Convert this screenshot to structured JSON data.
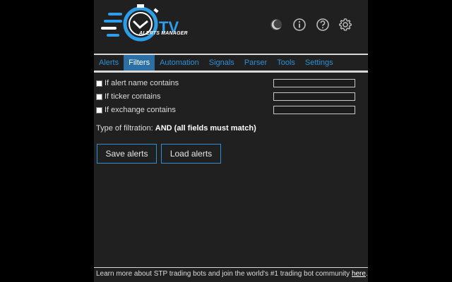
{
  "header": {
    "logo_text": "TV",
    "logo_subtext": "ALERTS MANAGER",
    "icons": [
      "moon-icon",
      "info-icon",
      "help-icon",
      "gear-icon"
    ]
  },
  "tabs": [
    {
      "label": "Alerts",
      "active": false
    },
    {
      "label": "Filters",
      "active": true
    },
    {
      "label": "Automation",
      "active": false
    },
    {
      "label": "Signals",
      "active": false
    },
    {
      "label": "Parser",
      "active": false
    },
    {
      "label": "Tools",
      "active": false
    },
    {
      "label": "Settings",
      "active": false
    }
  ],
  "filters": [
    {
      "label": "If alert name contains",
      "checked": false,
      "value": ""
    },
    {
      "label": "If ticker contains",
      "checked": false,
      "value": ""
    },
    {
      "label": "If exchange contains",
      "checked": false,
      "value": ""
    }
  ],
  "filtration": {
    "prefix": "Type of filtration:",
    "value": "AND (all fields must match)"
  },
  "buttons": {
    "save": "Save alerts",
    "load": "Load alerts"
  },
  "footer": {
    "text": "Learn more about STP trading bots and join the world's #1 trading bot community",
    "link": "here",
    "end": "."
  },
  "colors": {
    "accent": "#2e8fd6",
    "active_tab": "#2b6fa5",
    "panel_bg": "#202020",
    "page_bg": "#000000"
  }
}
